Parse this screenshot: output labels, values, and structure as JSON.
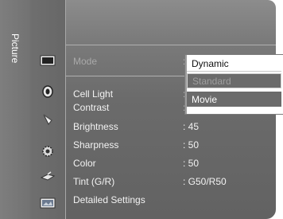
{
  "tab_label": "Picture",
  "menu": {
    "rows": [
      {
        "label": "Mode",
        "value": ":"
      },
      {
        "label": "Cell Light",
        "value": ":"
      },
      {
        "label": "Contrast",
        "value": ":"
      },
      {
        "label": "Brightness",
        "value": ": 45"
      },
      {
        "label": "Sharpness",
        "value": ": 50"
      },
      {
        "label": "Color",
        "value": ": 50"
      },
      {
        "label": "Tint (G/R)",
        "value": ": G50/R50"
      },
      {
        "label": "Detailed Settings",
        "value": ""
      }
    ]
  },
  "dropdown": {
    "options": [
      "Dynamic",
      "Standard",
      "Movie"
    ],
    "selected": "Dynamic",
    "disabled": "Standard"
  },
  "icons": [
    "picture-icon",
    "sound-icon",
    "channel-icon",
    "setup-icon",
    "input-icon",
    "application-icon"
  ]
}
